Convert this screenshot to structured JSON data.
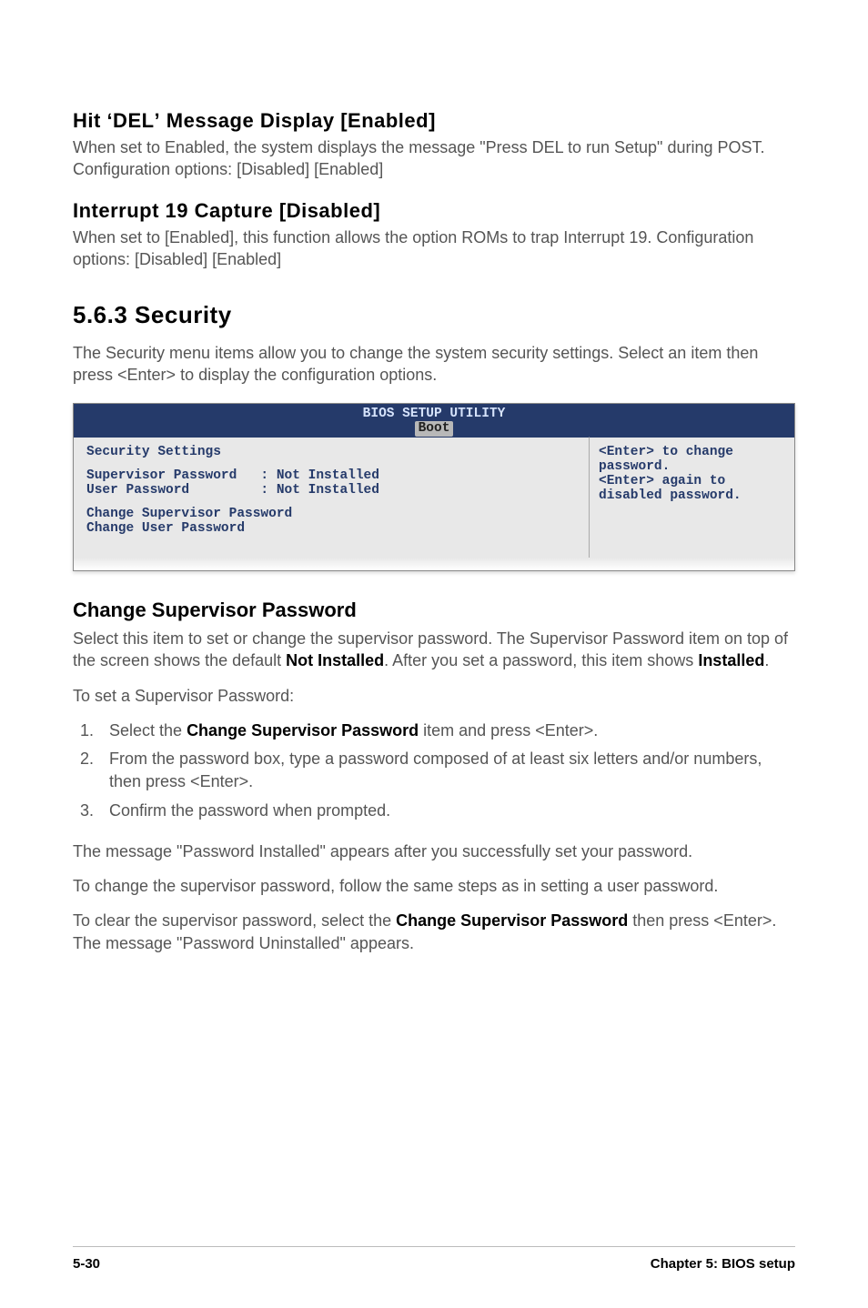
{
  "sectionA": {
    "heading": "Hit ʻDELʼ Message Display [Enabled]",
    "text": "When set to Enabled, the system displays the message \"Press DEL to run Setup\" during POST. Configuration options: [Disabled] [Enabled]"
  },
  "sectionB": {
    "heading": "Interrupt 19 Capture [Disabled]",
    "text": "When set to [Enabled], this function allows the option ROMs to trap Interrupt 19. Configuration options: [Disabled] [Enabled]"
  },
  "securityHeading": "5.6.3   Security",
  "securityIntro": "The Security menu items allow you to change the system security settings. Select an item then press <Enter> to display the configuration options.",
  "bios": {
    "title": "BIOS SETUP UTILITY",
    "tab": "Boot",
    "left": {
      "heading": "Security Settings",
      "rows": [
        "Supervisor Password   : Not Installed",
        "User Password         : Not Installed"
      ],
      "links": [
        "Change Supervisor Password",
        "Change User Password"
      ]
    },
    "right": "<Enter> to change password.\n<Enter> again to disabled password."
  },
  "changeSup": {
    "heading": "Change Supervisor Password",
    "p1a": "Select this item to set or change the supervisor password. The Supervisor Password item on top of the screen shows the default ",
    "p1b": "Not Installed",
    "p1c": ". After you set a password, this item shows ",
    "p1d": "Installed",
    "p1e": ".",
    "p2": "To set a Supervisor Password:",
    "steps": {
      "s1a": "Select the ",
      "s1b": "Change Supervisor Password",
      "s1c": " item and press <Enter>.",
      "s2": "From the password box, type a password composed of at least six letters and/or numbers, then press <Enter>.",
      "s3": "Confirm the password when prompted."
    },
    "p3": "The message \"Password Installed\" appears after you successfully set your password.",
    "p4": "To change the supervisor password, follow the same steps as in setting a user password.",
    "p5a": "To clear the supervisor password, select the ",
    "p5b": "Change Supervisor Password",
    "p5c": " then press <Enter>. The message \"Password Uninstalled\" appears."
  },
  "footer": {
    "left": "5-30",
    "right": "Chapter 5: BIOS setup"
  }
}
